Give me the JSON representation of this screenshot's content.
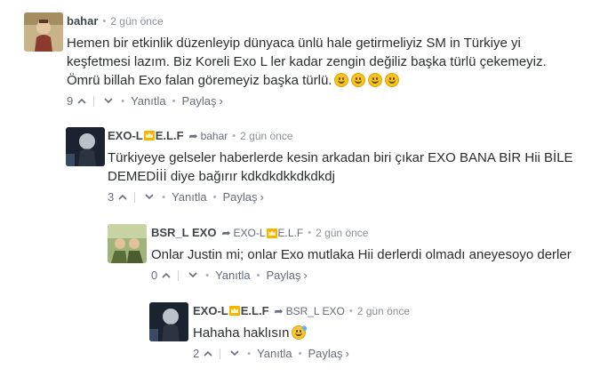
{
  "comments": [
    {
      "author": "bahar",
      "reply_to": "",
      "time": "2 gün önce",
      "text": "Hemen bir etkinlik düzenleyip dünyaca ünlü hale getirmeliyiz SM in Türkiye yi keşfetmesi lazım. Biz Koreli Exo L ler kadar zengin değiliz başka türlü çekemeyiz. Ömrü billah Exo falan göremeyiz başka türlü.",
      "emoji_icons": [
        "smile-emoji-icon",
        "smile-emoji-icon",
        "smile-emoji-icon",
        "smile-emoji-icon"
      ],
      "votes": "9"
    },
    {
      "author_prefix": "EXO-L",
      "author_suffix": "E.L.F",
      "reply_to": "bahar",
      "time": "2 gün önce",
      "text": "Türkiyeye gelseler haberlerde kesin arkadan biri çıkar EXO BANA BİR Hii BİLE DEMEDİİİ diye bağırır kdkdkdkkdkdkdj",
      "votes": "3"
    },
    {
      "author": "BSR_L EXO",
      "reply_to_prefix": "EXO-L",
      "reply_to_suffix": "E.L.F",
      "time": "2 gün önce",
      "text": "Onlar Justin mi; onlar Exo mutlaka Hii derlerdi olmadı aneyesoyo derler",
      "votes": "0"
    },
    {
      "author_prefix": "EXO-L",
      "author_suffix": "E.L.F",
      "reply_to": "BSR_L EXO",
      "time": "2 gün önce",
      "text": "Hahaha haklısın",
      "emoji_icons": [
        "sweat-smile-emoji-icon"
      ],
      "votes": "2"
    }
  ],
  "labels": {
    "reply": "Yanıtla",
    "share": "Paylaş",
    "share_chevron": "›",
    "dot": "•"
  },
  "colors": {
    "crown": "#f4b400",
    "text": "#2a2e2e",
    "meta": "#656c7a"
  }
}
